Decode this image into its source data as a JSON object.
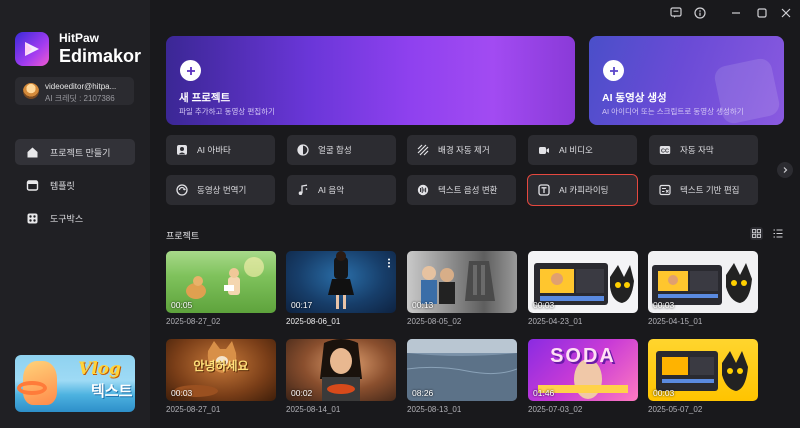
{
  "brand": {
    "top": "HitPaw",
    "name": "Edimakor"
  },
  "account": {
    "email": "videoeditor@hitpa...",
    "credit": "AI 크레딧 : 2107386"
  },
  "nav": [
    {
      "label": "프로젝트 만들기",
      "icon": "home-icon"
    },
    {
      "label": "템플릿",
      "icon": "template-icon"
    },
    {
      "label": "도구박스",
      "icon": "toolbox-icon"
    }
  ],
  "promo": {
    "title": "Vlog",
    "subtitle": "텍스트"
  },
  "hero": {
    "new": {
      "title": "새 프로젝트",
      "subtitle": "파일 추가하고 동영상 편집하기"
    },
    "ai": {
      "title": "AI 동영상 생성",
      "subtitle": "AI 아이디어 또는 스크립트로 동영상 생성하기"
    }
  },
  "features": [
    {
      "label": "AI 아바타",
      "icon": "avatar-icon"
    },
    {
      "label": "얼굴 합성",
      "icon": "face-swap-icon"
    },
    {
      "label": "배경 자동 제거",
      "icon": "background-remove-icon"
    },
    {
      "label": "AI 비디오",
      "icon": "ai-video-icon"
    },
    {
      "label": "자동 자막",
      "icon": "caption-icon"
    },
    {
      "label": "동영상 번역기",
      "icon": "translate-icon"
    },
    {
      "label": "AI 음악",
      "icon": "music-icon"
    },
    {
      "label": "텍스트 음성 변환",
      "icon": "text-to-speech-icon"
    },
    {
      "label": "AI 카피라이팅",
      "icon": "copywriting-icon",
      "selected": true
    },
    {
      "label": "텍스트 기반 편집",
      "icon": "text-edit-icon"
    }
  ],
  "projects_title": "프로젝트",
  "projects": [
    {
      "duration": "00:05",
      "name": "2025-08-27_02"
    },
    {
      "duration": "00:17",
      "name": "2025-08-06_01"
    },
    {
      "duration": "00:13",
      "name": "2025-08-05_02"
    },
    {
      "duration": "00:03",
      "name": "2025-04-23_01"
    },
    {
      "duration": "00:03",
      "name": "2025-04-15_01"
    },
    {
      "duration": "00:03",
      "name": "2025-08-27_01",
      "caption": "안녕하세요"
    },
    {
      "duration": "00:02",
      "name": "2025-08-14_01"
    },
    {
      "duration": "08:26",
      "name": "2025-08-13_01"
    },
    {
      "duration": "01:46",
      "name": "2025-07-03_02",
      "caption": "SODA"
    },
    {
      "duration": "00:03",
      "name": "2025-05-07_02"
    }
  ],
  "colors": {
    "accent": "#8f41ef",
    "selected_outline": "#e5483f",
    "background": "#19191c"
  }
}
